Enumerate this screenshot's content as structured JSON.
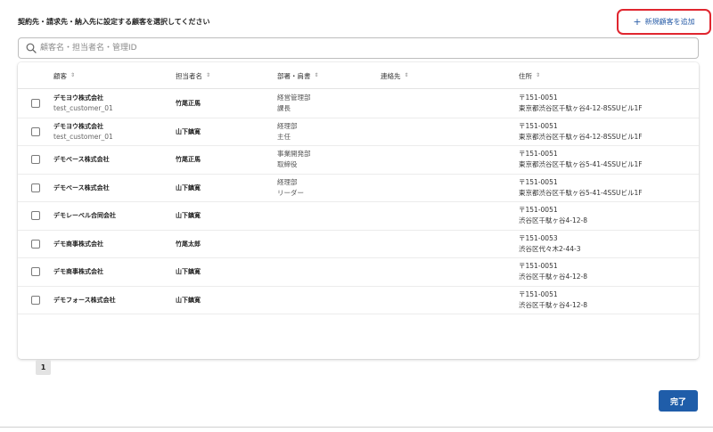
{
  "instruction": "契約先・請求先・納入先に設定する顧客を選択してください",
  "add_button": {
    "icon": "plus-icon",
    "label": "新規顧客を追加"
  },
  "search": {
    "placeholder": "顧客名・担当者名・管理ID",
    "value": ""
  },
  "table": {
    "headers": [
      {
        "label": "顧客"
      },
      {
        "label": "担当者名"
      },
      {
        "label": "部署・肩書"
      },
      {
        "label": "連絡先"
      },
      {
        "label": "住所"
      }
    ],
    "rows": [
      {
        "customer": "デモヨウ株式会社",
        "customer_id": "test_customer_01",
        "contact": "竹尾正馬",
        "dept": "経営管理部",
        "title": "課長",
        "phone": "",
        "postal": "〒151-0051",
        "address": "東京都渋谷区千駄ヶ谷4-12-8SSUビル1F"
      },
      {
        "customer": "デモヨウ株式会社",
        "customer_id": "test_customer_01",
        "contact": "山下鎮寛",
        "dept": "経理部",
        "title": "主任",
        "phone": "",
        "postal": "〒151-0051",
        "address": "東京都渋谷区千駄ヶ谷4-12-8SSUビル1F"
      },
      {
        "customer": "デモベース株式会社",
        "customer_id": "",
        "contact": "竹尾正馬",
        "dept": "事業開発部",
        "title": "取締役",
        "phone": "",
        "postal": "〒151-0051",
        "address": "東京都渋谷区千駄ヶ谷5-41-4SSUビル1F"
      },
      {
        "customer": "デモベース株式会社",
        "customer_id": "",
        "contact": "山下鎮寛",
        "dept": "経理部",
        "title": "リーダー",
        "phone": "",
        "postal": "〒151-0051",
        "address": "東京都渋谷区千駄ヶ谷5-41-4SSUビル1F"
      },
      {
        "customer": "デモレーベル合同会社",
        "customer_id": "",
        "contact": "山下鎮寛",
        "dept": "",
        "title": "",
        "phone": "",
        "postal": "〒151-0051",
        "address": "渋谷区千駄ヶ谷4-12-8"
      },
      {
        "customer": "デモ商事株式会社",
        "customer_id": "",
        "contact": "竹尾太郎",
        "dept": "",
        "title": "",
        "phone": "",
        "postal": "〒151-0053",
        "address": "渋谷区代々木2-44-3"
      },
      {
        "customer": "デモ商事株式会社",
        "customer_id": "",
        "contact": "山下鎮寛",
        "dept": "",
        "title": "",
        "phone": "",
        "postal": "〒151-0051",
        "address": "渋谷区千駄ヶ谷4-12-8"
      },
      {
        "customer": "デモフォース株式会社",
        "customer_id": "",
        "contact": "山下鎮寛",
        "dept": "",
        "title": "",
        "phone": "",
        "postal": "〒151-0051",
        "address": "渋谷区千駄ヶ谷4-12-8"
      }
    ]
  },
  "pagination": {
    "current_page": "1"
  },
  "done_button": {
    "label": "完了"
  },
  "colors": {
    "accent": "#1f5da9",
    "highlight_border": "#e0262f",
    "link": "#2a5ea8"
  }
}
